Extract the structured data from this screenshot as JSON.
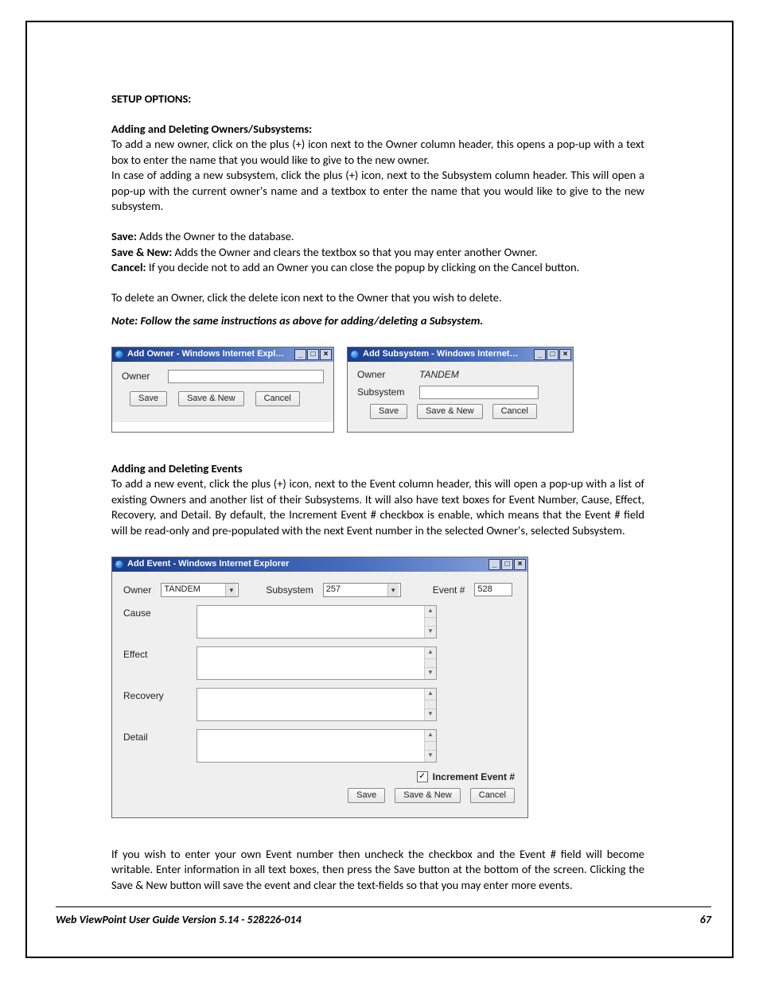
{
  "hdr": {
    "setup_options": "SETUP OPTIONS:",
    "add_del_owners": "Adding and Deleting Owners/Subsystems:"
  },
  "txt": {
    "para1": "To add a new owner, click on the plus (+) icon next to the Owner column header, this opens a pop-up with a text box to enter the name that you would like to give to the new owner.",
    "para2": "In case of adding a new subsystem, click the plus (+) icon, next to the Subsystem column header. This will open a pop-up with the current owner's name and a textbox to enter the name that you would like to give to the new subsystem.",
    "save_b": "Save:",
    "save_t": " Adds the Owner to the database.",
    "savenew_b": "Save & New:",
    "savenew_t": " Adds the Owner and clears the textbox so that you may enter another Owner.",
    "cancel_b": "Cancel:",
    "cancel_t": " If you decide not to add an Owner you can close the popup by clicking on the Cancel button.",
    "del_owner": "To delete an Owner, click the delete icon next to the Owner that you wish to delete.",
    "note": "Note: Follow the same instructions as above for adding/deleting a Subsystem.",
    "add_del_events": "Adding and Deleting Events",
    "events_para": "To add a new event, click the plus (+) icon, next to the Event column header, this will open a pop-up with a list of existing Owners and another list of their Subsystems. It will also have text boxes for Event Number, Cause, Effect, Recovery, and Detail. By default, the Increment Event # checkbox is enable, which means that the Event # field will be read-only and pre-populated with the next Event number in the selected Owner's, selected Subsystem.",
    "final_para": " If you wish to enter your own Event number then uncheck the checkbox and the Event # field will become writable. Enter information in all text boxes, then press the Save button at the bottom of the screen. Clicking the Save & New button will save the event and clear the text-fields so that you may enter more events."
  },
  "popOwner": {
    "title": "Add Owner - Windows Internet Expl…",
    "lab_owner": "Owner",
    "btn_save": "Save",
    "btn_savenew": "Save & New",
    "btn_cancel": "Cancel"
  },
  "popSub": {
    "title": "Add Subsystem - Windows Internet…",
    "lab_owner": "Owner",
    "val_owner": "TANDEM",
    "lab_subsystem": "Subsystem",
    "btn_save": "Save",
    "btn_savenew": "Save & New",
    "btn_cancel": "Cancel"
  },
  "popEvent": {
    "title": "Add Event - Windows Internet Explorer",
    "lab_owner": "Owner",
    "val_owner": "TANDEM",
    "lab_subsystem": "Subsystem",
    "val_subsystem": "257",
    "lab_event": "Event #",
    "val_event": "528",
    "lab_cause": "Cause",
    "lab_effect": "Effect",
    "lab_recovery": "Recovery",
    "lab_detail": "Detail",
    "lab_inc": "Increment Event #",
    "btn_save": "Save",
    "btn_savenew": "Save & New",
    "btn_cancel": "Cancel"
  },
  "footer": {
    "left": "Web ViewPoint User Guide Version 5.14 - 528226-014",
    "right": "67"
  }
}
